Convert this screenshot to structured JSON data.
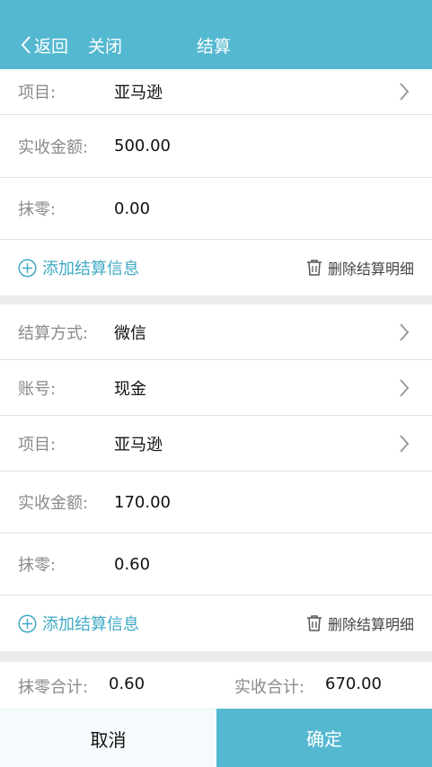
{
  "header": {
    "back_label": "返回",
    "close_label": "关闭",
    "title": "结算"
  },
  "block1": {
    "project": {
      "label": "项目:",
      "value": "亚马逊"
    },
    "received": {
      "label": "实收金额:",
      "value": "500.00"
    },
    "rounding": {
      "label": "抹零:",
      "value": "0.00"
    },
    "add_label": "添加结算信息",
    "delete_label": "删除结算明细"
  },
  "block2": {
    "method": {
      "label": "结算方式:",
      "value": "微信"
    },
    "account": {
      "label": "账号:",
      "value": "现金"
    },
    "project": {
      "label": "项目:",
      "value": "亚马逊"
    },
    "received": {
      "label": "实收金额:",
      "value": "170.00"
    },
    "rounding": {
      "label": "抹零:",
      "value": "0.60"
    },
    "add_label": "添加结算信息",
    "delete_label": "删除结算明细"
  },
  "summary": {
    "rounding_total_label": "抹零合计:",
    "rounding_total_value": "0.60",
    "received_total_label": "实收合计:",
    "received_total_value": "670.00"
  },
  "footer": {
    "cancel_label": "取消",
    "confirm_label": "确定"
  },
  "colors": {
    "accent": "#54b8d0",
    "link": "#3fa9c4",
    "gap": "#ececec"
  }
}
